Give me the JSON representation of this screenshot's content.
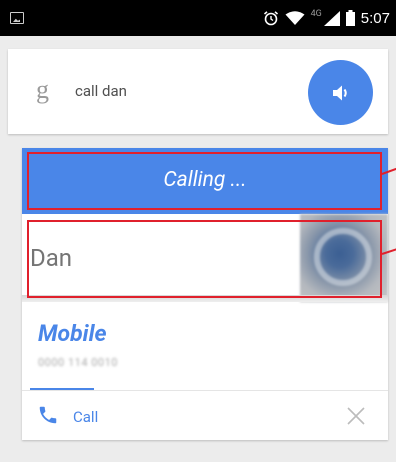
{
  "status_bar": {
    "network_label": "4G",
    "time": "5:07",
    "icons": [
      "image-icon",
      "alarm-icon",
      "wifi-icon",
      "signal-icon",
      "battery-icon"
    ]
  },
  "search": {
    "logo": "g",
    "query": "call dan",
    "speak_icon": "speaker-icon"
  },
  "call_card": {
    "status": "Calling ...",
    "contact_name": "Dan",
    "number_type": "Mobile",
    "number": "0000 114 0010",
    "action_label": "Call",
    "action_icon": "phone-icon",
    "dismiss_icon": "close-icon"
  },
  "colors": {
    "accent": "#4a86e8",
    "annotation": "#e0202c"
  }
}
